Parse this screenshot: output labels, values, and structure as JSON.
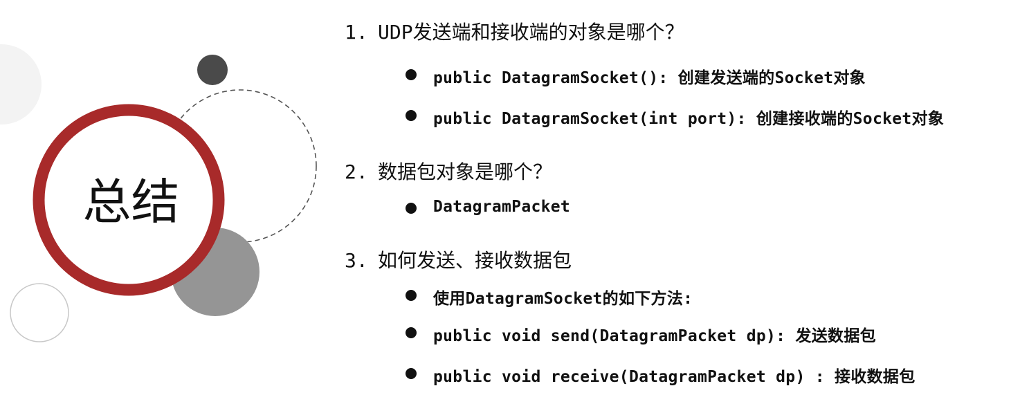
{
  "slide": {
    "title": "总结",
    "sections": [
      {
        "number": "1.",
        "question": "UDP发送端和接收端的对象是哪个？",
        "bullets": [
          "public DatagramSocket(): 创建发送端的Socket对象",
          "public DatagramSocket(int port): 创建接收端的Socket对象"
        ]
      },
      {
        "number": "2.",
        "question": "数据包对象是哪个？",
        "bullets": [
          "DatagramPacket"
        ]
      },
      {
        "number": "3.",
        "question": "如何发送、接收数据包",
        "bullets": [
          "使用DatagramSocket的如下方法:",
          "public void send(DatagramPacket dp): 发送数据包",
          "public void receive(DatagramPacket dp) : 接收数据包"
        ]
      }
    ]
  },
  "colors": {
    "ring": "#a82a2a",
    "dark_circle": "#4a4a4a",
    "gray_circle": "#959595",
    "light_circle": "#f3f3f3"
  }
}
